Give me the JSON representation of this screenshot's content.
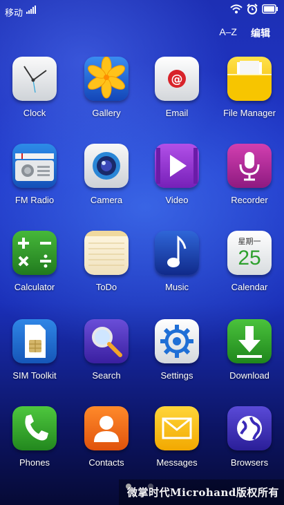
{
  "status_bar": {
    "carrier": "移动",
    "icons": [
      "signal-icon",
      "wifi-icon",
      "alarm-icon",
      "battery-icon"
    ]
  },
  "top_bar": {
    "sort_label": "A–Z",
    "edit_label": "编辑"
  },
  "apps": [
    {
      "label": "Clock",
      "icon": "clock-icon"
    },
    {
      "label": "Gallery",
      "icon": "gallery-icon"
    },
    {
      "label": "Email",
      "icon": "email-icon"
    },
    {
      "label": "File Manager",
      "icon": "file-manager-icon"
    },
    {
      "label": "FM Radio",
      "icon": "fm-radio-icon"
    },
    {
      "label": "Camera",
      "icon": "camera-icon"
    },
    {
      "label": "Video",
      "icon": "video-icon"
    },
    {
      "label": "Recorder",
      "icon": "recorder-icon"
    },
    {
      "label": "Calculator",
      "icon": "calculator-icon"
    },
    {
      "label": "ToDo",
      "icon": "todo-icon"
    },
    {
      "label": "Music",
      "icon": "music-icon"
    },
    {
      "label": "Calendar",
      "icon": "calendar-icon"
    },
    {
      "label": "SIM Toolkit",
      "icon": "sim-toolkit-icon"
    },
    {
      "label": "Search",
      "icon": "search-icon"
    },
    {
      "label": "Settings",
      "icon": "settings-icon"
    },
    {
      "label": "Download",
      "icon": "download-icon"
    },
    {
      "label": "Phones",
      "icon": "phone-icon"
    },
    {
      "label": "Contacts",
      "icon": "contacts-icon"
    },
    {
      "label": "Messages",
      "icon": "messages-icon"
    },
    {
      "label": "Browsers",
      "icon": "browser-icon"
    }
  ],
  "calendar_tile": {
    "weekday": "星期一",
    "day": "25"
  },
  "page_indicator": {
    "pages": 2,
    "current": 1
  },
  "watermark": "微掌时代Microhand版权所有",
  "colors": {
    "background": "#1f36c9",
    "text": "#ffffff"
  }
}
